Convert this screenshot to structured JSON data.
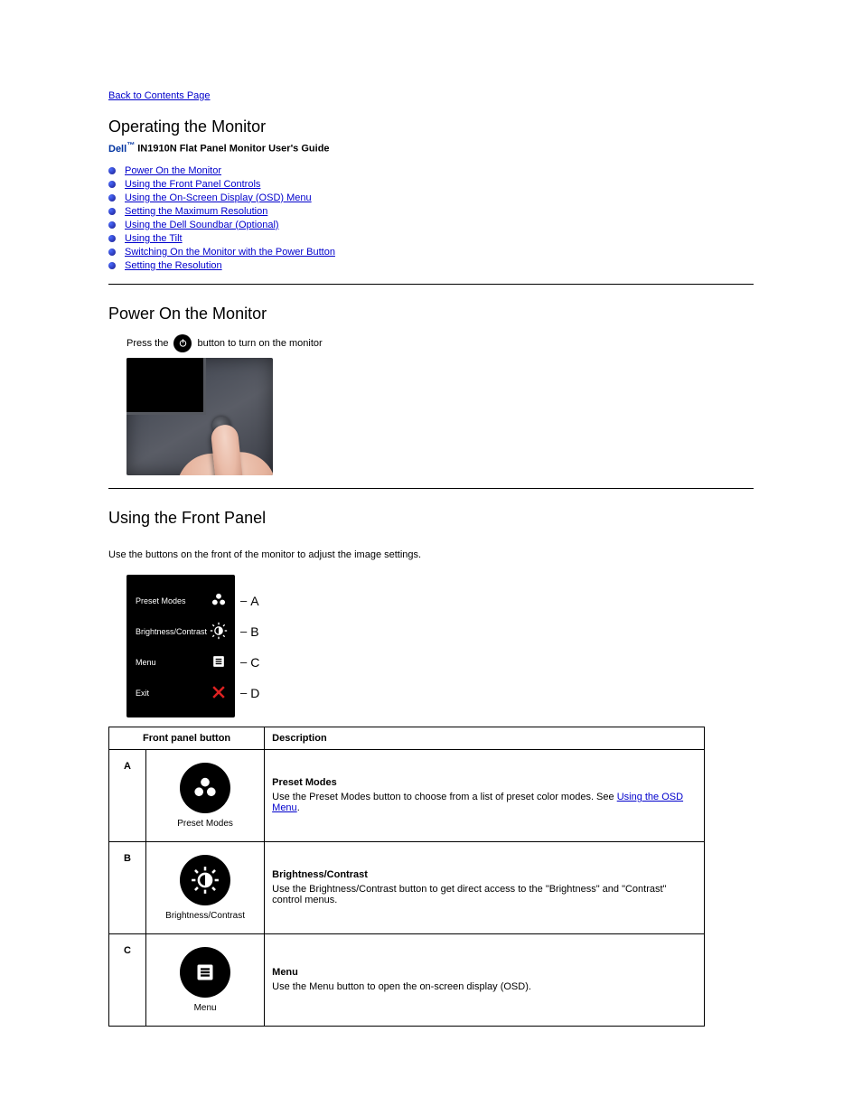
{
  "nav": {
    "back": "Back to Contents Page"
  },
  "headings": {
    "main": "Operating the Monitor",
    "product_prefix": "Dell",
    "product": " IN1910N Flat Panel Monitor User's Guide",
    "power": "Power On the Monitor",
    "front_panel": "Using the Front Panel"
  },
  "toc": [
    "Power On the Monitor",
    "Using the Front Panel Controls",
    "Using the On-Screen Display (OSD) Menu",
    "Setting the Maximum Resolution",
    "Using the Dell Soundbar (Optional)",
    "Using the Tilt",
    "Switching On the Monitor with the Power Button",
    "Setting the Resolution"
  ],
  "power": {
    "prefix": "Press the ",
    "suffix": " button to turn on the monitor"
  },
  "front_panel": {
    "intro": "Use the buttons on the front of the monitor to adjust the image settings.",
    "panel": {
      "a_label": "Preset Modes",
      "b_label": "Brightness/Contrast",
      "c_label": "Menu",
      "d_label": "Exit"
    },
    "letters": {
      "a": "A",
      "b": "B",
      "c": "C",
      "d": "D"
    },
    "table": {
      "col1": "Front panel button",
      "col2": "Description",
      "rows": {
        "a": {
          "letter": "A",
          "name": "Preset Modes",
          "title": "Preset Modes",
          "desc_pre": "Use the Preset Modes button to choose from a list of preset color modes. See ",
          "desc_link": "Using the OSD Menu",
          "desc_post": "."
        },
        "b": {
          "letter": "B",
          "name": "Brightness/Contrast",
          "title": "Brightness/Contrast",
          "desc": "Use the Brightness/Contrast button to get direct access to the \"Brightness\" and \"Contrast\" control menus."
        },
        "c": {
          "letter": "C",
          "name": "Menu",
          "title": "Menu",
          "desc": "Use the Menu button to open the on-screen display (OSD)."
        }
      }
    }
  }
}
